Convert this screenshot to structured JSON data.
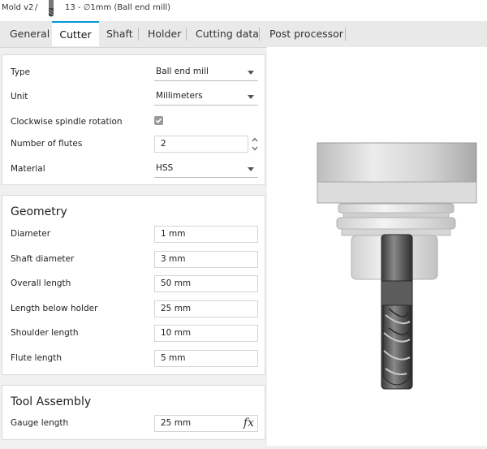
{
  "breadcrumb": {
    "document": "Mold v2",
    "separator": "/",
    "tool": "13 - ∅1mm (Ball end mill)"
  },
  "tabs": [
    {
      "label": "General",
      "active": false
    },
    {
      "label": "Cutter",
      "active": true
    },
    {
      "label": "Shaft",
      "active": false
    },
    {
      "label": "Holder",
      "active": false
    },
    {
      "label": "Cutting data",
      "active": false
    },
    {
      "label": "Post processor",
      "active": false
    }
  ],
  "cutter": {
    "type": {
      "label": "Type",
      "value": "Ball end mill"
    },
    "unit": {
      "label": "Unit",
      "value": "Millimeters"
    },
    "clockwise": {
      "label": "Clockwise spindle rotation",
      "checked": true
    },
    "flutes": {
      "label": "Number of flutes",
      "value": "2"
    },
    "material": {
      "label": "Material",
      "value": "HSS"
    }
  },
  "geometry": {
    "title": "Geometry",
    "diameter": {
      "label": "Diameter",
      "value": "1 mm"
    },
    "shaft_diameter": {
      "label": "Shaft diameter",
      "value": "3 mm"
    },
    "overall_length": {
      "label": "Overall length",
      "value": "50 mm"
    },
    "length_below_holder": {
      "label": "Length below holder",
      "value": "25 mm"
    },
    "shoulder_length": {
      "label": "Shoulder length",
      "value": "10 mm"
    },
    "flute_length": {
      "label": "Flute length",
      "value": "5 mm"
    }
  },
  "tool_assembly": {
    "title": "Tool Assembly",
    "gauge_length": {
      "label": "Gauge length",
      "value": "25 mm",
      "expression_icon": "fx"
    }
  },
  "colors": {
    "accent": "#0696d7"
  },
  "icons": [
    "ball-end-mill-thumbnail-icon",
    "checkbox-check-icon",
    "dropdown-caret-icon",
    "stepper-arrows-icon",
    "function-expression-icon",
    "tool-holder-preview"
  ]
}
